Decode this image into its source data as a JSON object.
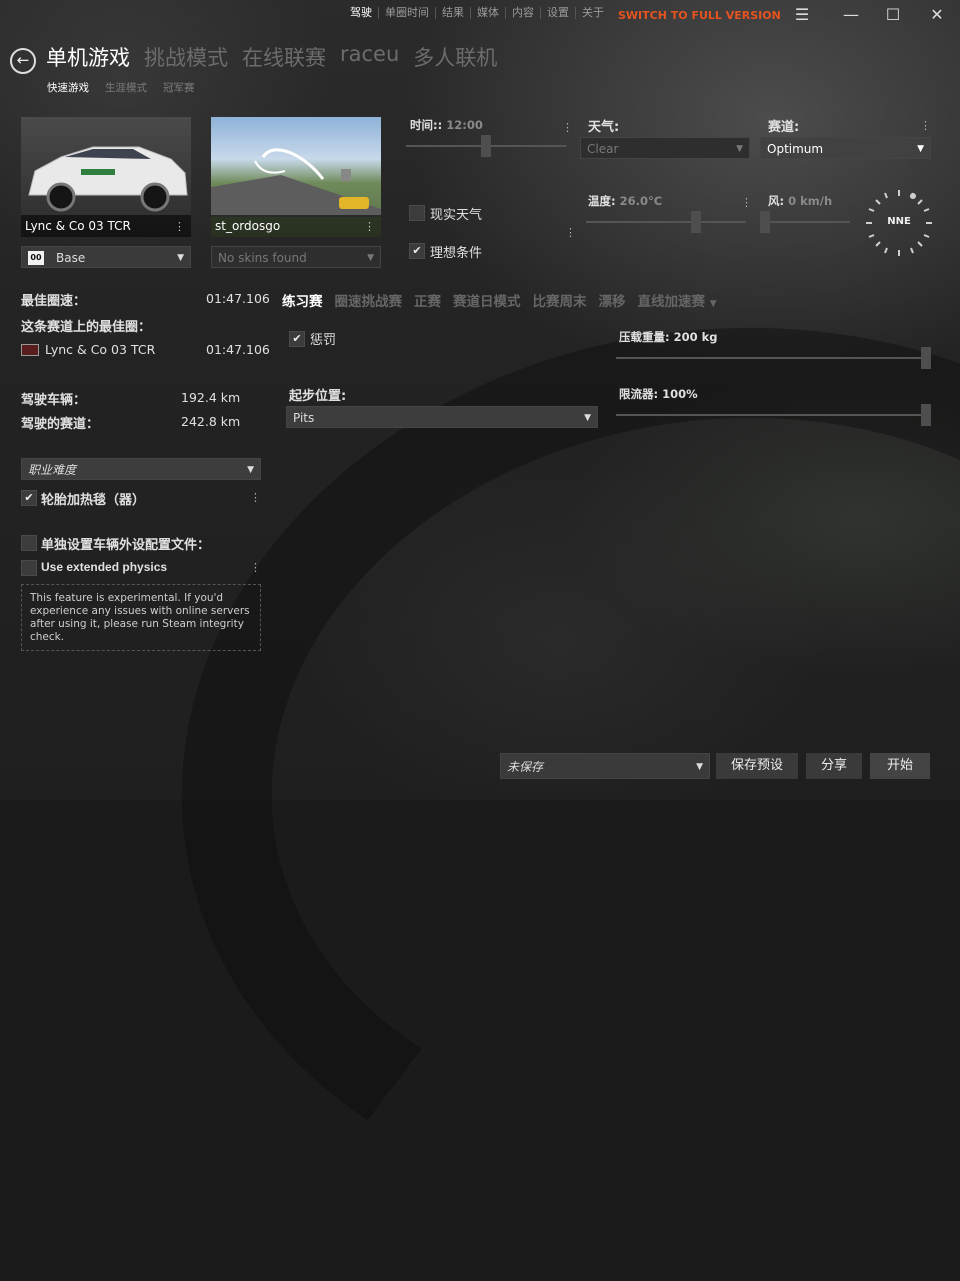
{
  "topnav": {
    "items": [
      "驾驶",
      "单圈时间",
      "结果",
      "媒体",
      "内容",
      "设置",
      "关于"
    ],
    "full_version": "SWITCH TO FULL VERSION",
    "controls": [
      "menu-icon",
      "minimize-icon",
      "maximize-icon",
      "close-icon"
    ]
  },
  "header": {
    "tabs": [
      "单机游戏",
      "挑战模式",
      "在线联赛",
      "raceu",
      "多人联机"
    ],
    "active_tab": 0,
    "subtabs": [
      "快速游戏",
      "生涯模式",
      "冠军赛"
    ],
    "active_subtab": 0
  },
  "car": {
    "name": "Lync & Co 03 TCR",
    "skin": "Base",
    "skin_badge": "00"
  },
  "track": {
    "name": "st_ordosgo",
    "skin": "No skins found"
  },
  "conditions": {
    "time_label": "时间::",
    "time_value": "12:00",
    "weather_label": "天气:",
    "weather_value": "Clear",
    "track_state_label": "赛道:",
    "track_state_value": "Optimum",
    "real_weather_label": "现实天气",
    "real_weather_checked": false,
    "ideal_label": "理想条件",
    "ideal_checked": true,
    "temp_label": "温度:",
    "temp_value": "26.0°C",
    "wind_label": "风:",
    "wind_value": "0 km/h",
    "compass": "NNE",
    "time_level": 0.5,
    "temp_level": 0.7,
    "wind_level": 0.0
  },
  "stats": {
    "best_lap_label": "最佳圈速：",
    "best_lap_value": "01:47.106",
    "best_on_track_label": "这条赛道上的最佳圈：",
    "best_on_track_car": "Lync & Co 03 TCR",
    "best_on_track_value": "01:47.106",
    "driven_car_label": "驾驶车辆：",
    "driven_car_value": "192.4 km",
    "driven_track_label": "驾驶的赛道：",
    "driven_track_value": "242.8 km"
  },
  "assists": {
    "difficulty": "职业难度",
    "tyre_blankets_label": "轮胎加热毯（器）",
    "tyre_blankets_checked": true,
    "separate_config_label": "单独设置车辆外设配置文件：",
    "separate_config_checked": false,
    "extended_physics_label": "Use extended physics",
    "extended_physics_checked": false,
    "note": "This feature is experimental. If you'd experience any issues with online servers after using it, please run Steam integrity check."
  },
  "modes": {
    "items": [
      "练习赛",
      "圈速挑战赛",
      "正赛",
      "赛道日模式",
      "比赛周末",
      "漂移",
      "直线加速赛"
    ],
    "active": 0,
    "more_icon": "chevron-down-icon"
  },
  "practice": {
    "penalty_label": "惩罚",
    "penalty_checked": true,
    "start_label": "起步位置:",
    "start_value": "Pits",
    "ballast_label": "压载重量:",
    "ballast_value": "200 kg",
    "ballast_level": 1.0,
    "restrictor_label": "限流器:",
    "restrictor_value": "100%",
    "restrictor_level": 1.0
  },
  "footer": {
    "preset": "未保存",
    "save_preset": "保存预设",
    "share": "分享",
    "start": "开始"
  }
}
